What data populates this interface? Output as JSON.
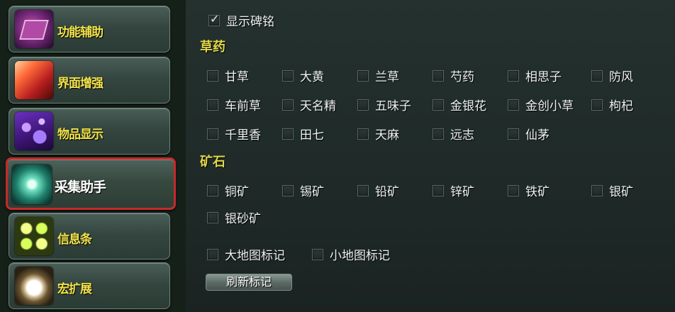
{
  "sidebar": {
    "items": [
      {
        "label": "功能辅助",
        "icon": "book-icon",
        "active": false
      },
      {
        "label": "界面增强",
        "icon": "fire-burst-icon",
        "active": false
      },
      {
        "label": "物品显示",
        "icon": "bubbles-icon",
        "active": false
      },
      {
        "label": "采集助手",
        "icon": "swirl-icon",
        "active": true
      },
      {
        "label": "信息条",
        "icon": "green-orbs-icon",
        "active": false
      },
      {
        "label": "宏扩展",
        "icon": "clock-icon",
        "active": false
      }
    ]
  },
  "options": {
    "show_tablet": {
      "label": "显示碑铭",
      "checked": true
    }
  },
  "herbs": {
    "title": "草药",
    "items": [
      "甘草",
      "大黄",
      "兰草",
      "芍药",
      "相思子",
      "防风",
      "车前草",
      "天名精",
      "五味子",
      "金银花",
      "金创小草",
      "枸杞",
      "千里香",
      "田七",
      "天麻",
      "远志",
      "仙茅"
    ]
  },
  "ores": {
    "title": "矿石",
    "items": [
      "铜矿",
      "锡矿",
      "铅矿",
      "锌矿",
      "铁矿",
      "银矿",
      "银砂矿"
    ]
  },
  "map_marks": {
    "world_map": {
      "label": "大地图标记",
      "checked": false
    },
    "mini_map": {
      "label": "小地图标记",
      "checked": false
    }
  },
  "refresh_button": {
    "label": "刷新标记"
  },
  "colors": {
    "section_title": "#e2d64a",
    "nav_label": "#f2e24a",
    "active_border": "#c42a2a"
  }
}
